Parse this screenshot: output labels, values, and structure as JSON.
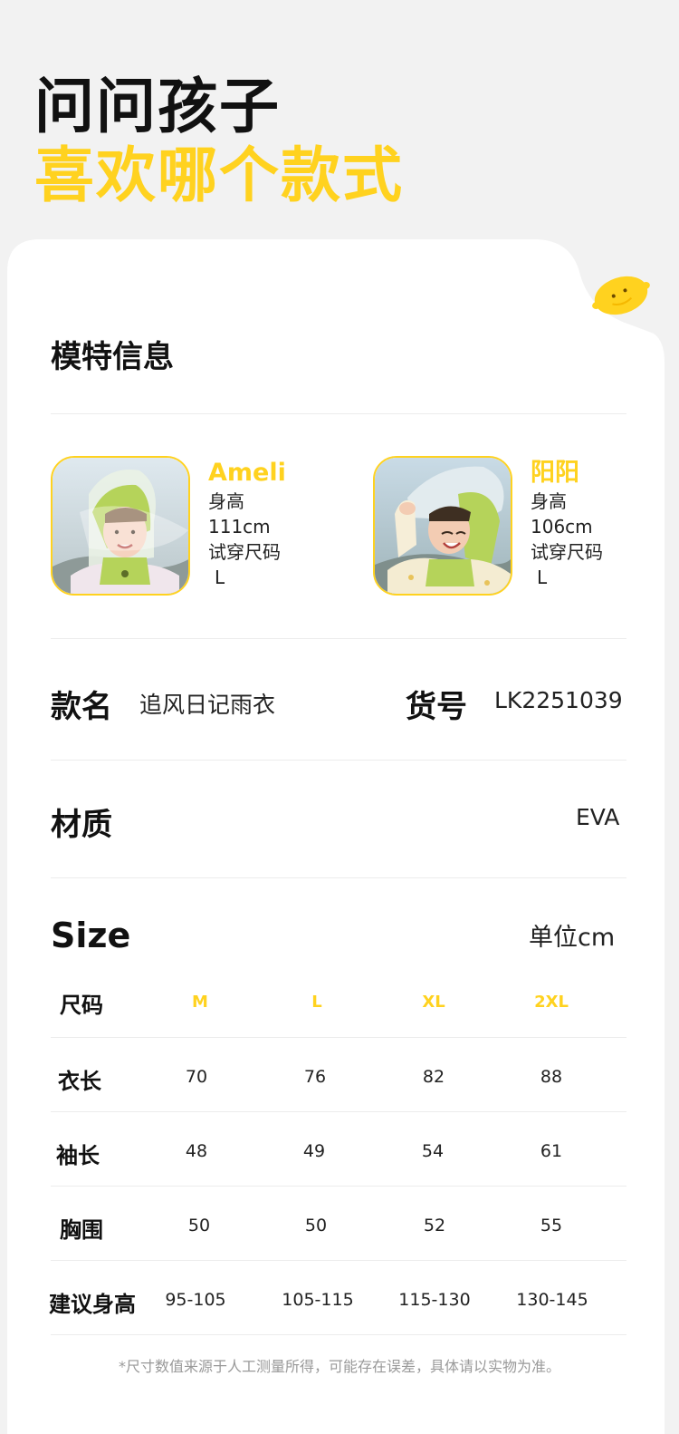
{
  "hero": {
    "line1": "问问孩子",
    "line2": "喜欢哪个款式"
  },
  "colors": {
    "accent": "#ffd21f",
    "background": "#f2f2f2",
    "card": "#ffffff"
  },
  "decor": {
    "icon": "lemon-icon"
  },
  "model_section": {
    "title": "模特信息",
    "models": [
      {
        "name": "Ameli",
        "height_label": "身高",
        "height": "111cm",
        "size_label": "试穿尺码",
        "size": "L"
      },
      {
        "name": "阳阳",
        "height_label": "身高",
        "height": "106cm",
        "size_label": "试穿尺码",
        "size": "L"
      }
    ]
  },
  "product": {
    "name_label": "款名",
    "name": "追风日记雨衣",
    "sku_label": "货号",
    "sku": "LK2251039",
    "material_label": "材质",
    "material": "EVA"
  },
  "size_table": {
    "title": "Size",
    "unit": "单位cm",
    "header_label": "尺码",
    "sizes": [
      "M",
      "L",
      "XL",
      "2XL"
    ],
    "rows": [
      {
        "label": "衣长",
        "values": [
          "70",
          "76",
          "82",
          "88"
        ]
      },
      {
        "label": "袖长",
        "values": [
          "48",
          "49",
          "54",
          "61"
        ]
      },
      {
        "label": "胸围",
        "values": [
          "50",
          "50",
          "52",
          "55"
        ]
      },
      {
        "label": "建议身高",
        "values": [
          "95-105",
          "105-115",
          "115-130",
          "130-145"
        ]
      }
    ]
  },
  "footnote": "*尺寸数值来源于人工测量所得，可能存在误差，具体请以实物为准。"
}
